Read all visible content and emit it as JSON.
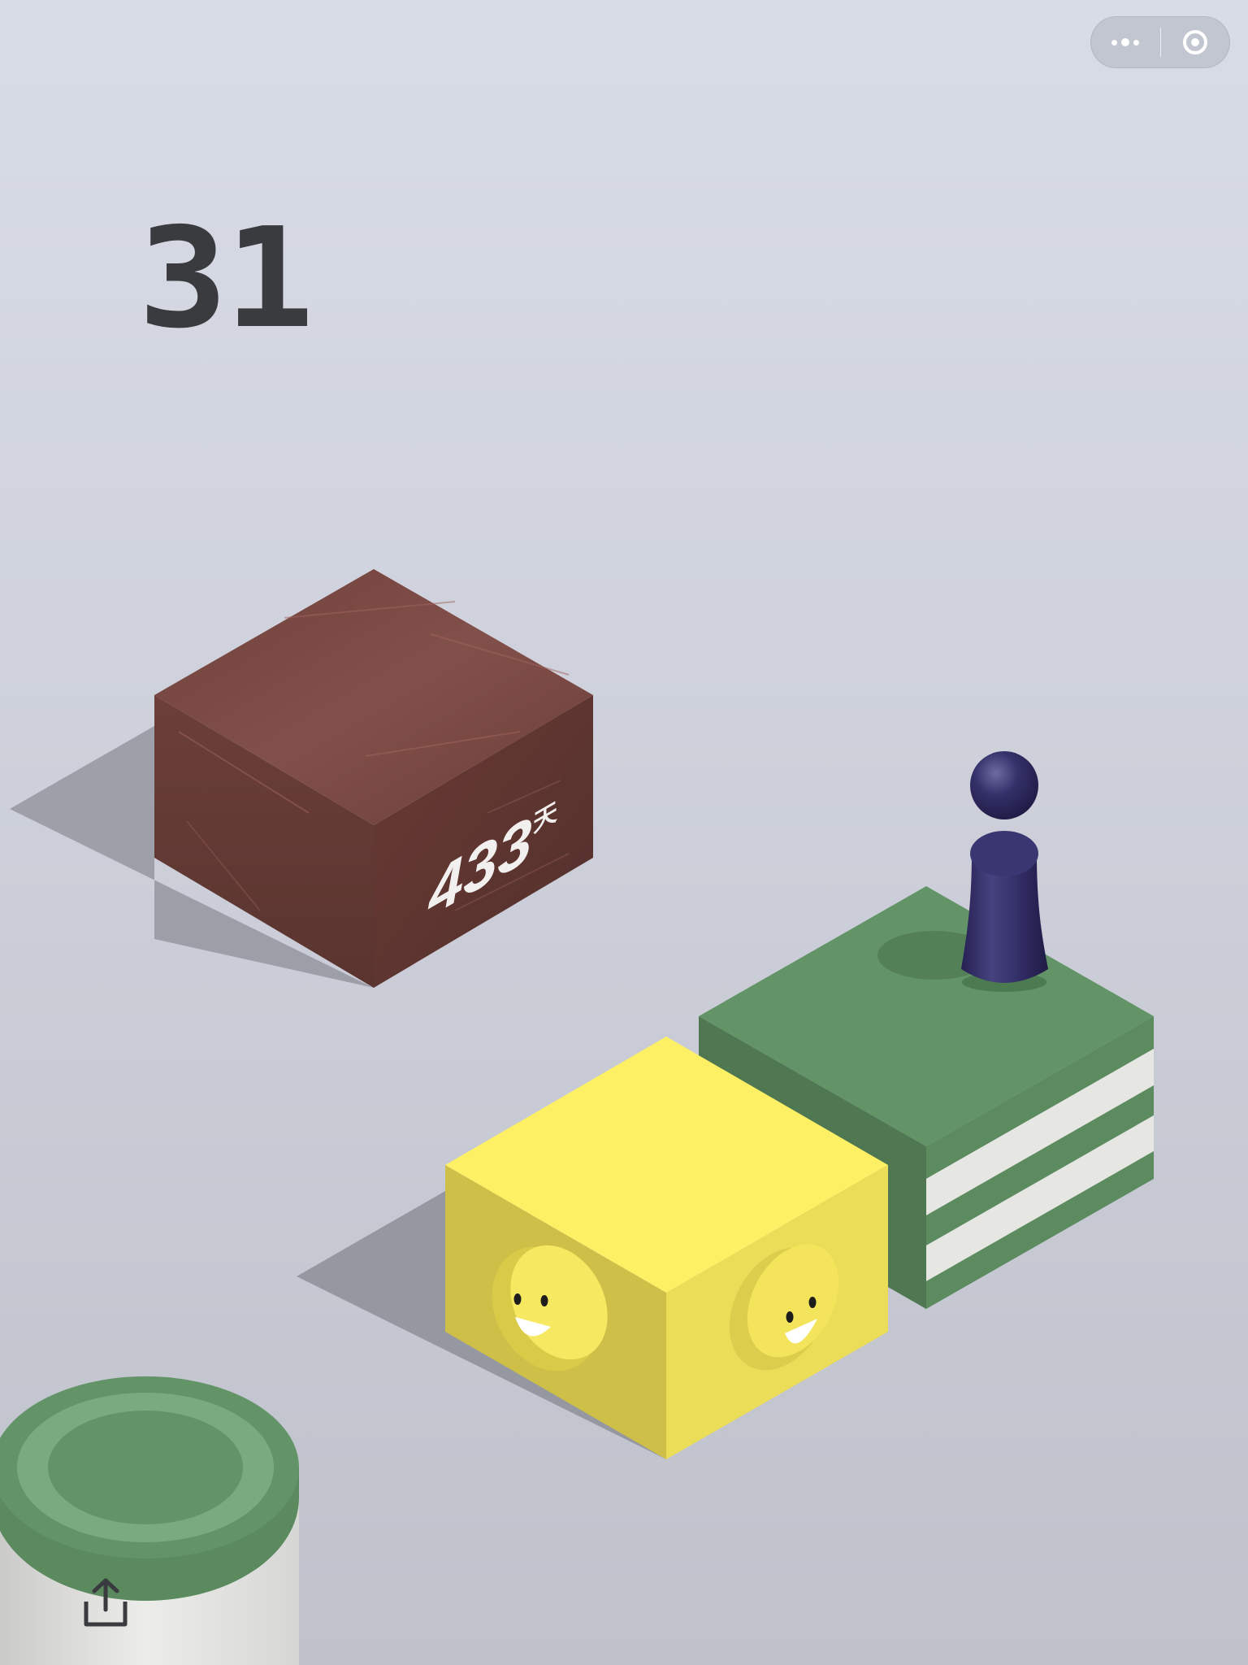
{
  "game": {
    "score": "31",
    "brown_block_label_number": "433",
    "brown_block_label_unit": "天"
  },
  "capsule": {
    "more_icon": "more-dots-icon",
    "close_icon": "target-circle-icon"
  },
  "share": {
    "icon": "share-upload-icon"
  },
  "colors": {
    "background_top": "#d8dce6",
    "background_bottom": "#bfc1cb",
    "score_text": "#3a3b3f",
    "yellow_top": "#fef065",
    "yellow_left": "#cdbf48",
    "yellow_right": "#ecdd58",
    "green_top": "#639468",
    "green_left": "#4e7752",
    "green_right": "#5a8a5e",
    "stripe_white": "#e6e6e3",
    "brown_top": "#7b4740",
    "brown_left": "#6a3d38",
    "brown_right": "#5e3531",
    "player": "#2e2a5c"
  }
}
